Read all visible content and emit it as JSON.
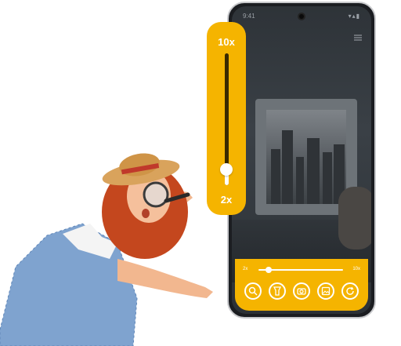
{
  "vertical_zoom": {
    "max_label": "10x",
    "min_label": "2x",
    "level": 0.12
  },
  "phone": {
    "status_time": "9:41",
    "status_icons": "▾▴▮",
    "zoom_bar": {
      "min_label": "2x",
      "max_label": "10x",
      "level": 0.12
    },
    "tools": [
      {
        "name": "magnifier-icon"
      },
      {
        "name": "flashlight-icon"
      },
      {
        "name": "camera-icon"
      },
      {
        "name": "gallery-icon"
      },
      {
        "name": "refresh-icon"
      }
    ]
  },
  "colors": {
    "accent": "#f5b400",
    "phone_body": "#1b1d21"
  }
}
